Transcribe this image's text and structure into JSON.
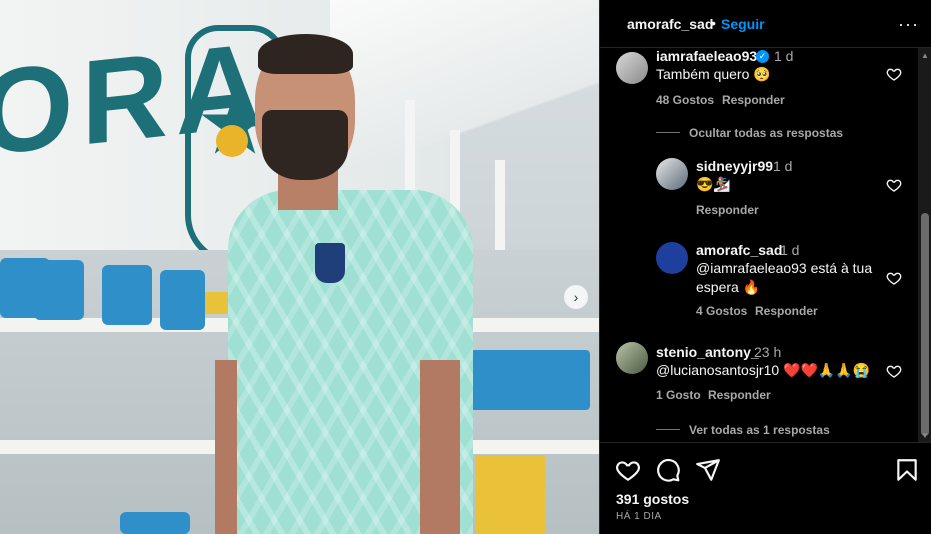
{
  "post": {
    "username": "amorafc_sad",
    "separator": "•",
    "follow_label": "Seguir",
    "more_label": "···",
    "likes": "391 gostos",
    "time_ago": "HÁ 1 DIA"
  },
  "photo": {
    "wall_text": "ORA",
    "next_label": "›"
  },
  "comments": {
    "c1": {
      "username": "iamrafaeleao93",
      "verified_mark": "✓",
      "time": "1 d",
      "text": "Também quero 🥺",
      "likes": "48 Gostos",
      "reply_label": "Responder"
    },
    "hide_replies": "Ocultar todas as respostas",
    "r1": {
      "username": "sidneyyjr99",
      "time": "1 d",
      "text": "😎🏂",
      "reply_label": "Responder"
    },
    "r2": {
      "username": "amorafc_sad",
      "time": "1 d",
      "text": "@iamrafaeleao93 está à tua espera 🔥",
      "likes": "4 Gostos",
      "reply_label": "Responder"
    },
    "c2": {
      "username": "stenio_antony_",
      "time": "23 h",
      "text": "@lucianosantosjr10 ❤️❤️🙏🙏😭",
      "likes": "1 Gosto",
      "reply_label": "Responder"
    },
    "view_replies": "Ver todas as 1 respostas"
  },
  "colors": {
    "accent": "#0095f6",
    "background": "#000000",
    "secondary_text": "#a8a8a8"
  },
  "icons": {
    "like": "heart-icon",
    "comment": "comment-icon",
    "share": "send-icon",
    "save": "bookmark-icon",
    "more": "more-icon"
  }
}
